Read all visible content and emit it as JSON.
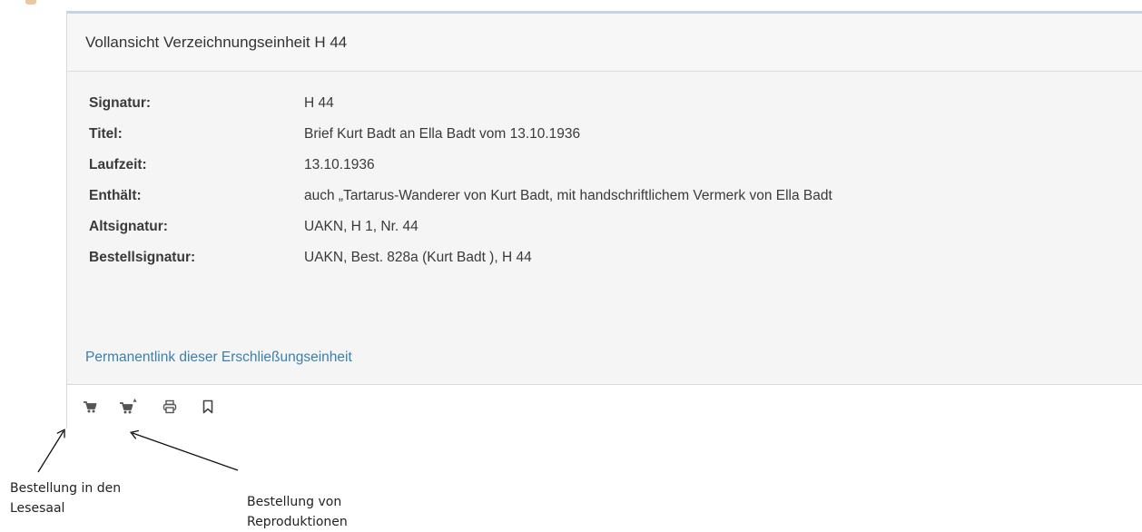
{
  "panel": {
    "title": "Vollansicht Verzeichnungseinheit H 44",
    "rows": [
      {
        "label": "Signatur:",
        "value": "H 44"
      },
      {
        "label": "Titel:",
        "value": "Brief Kurt Badt an Ella Badt vom 13.10.1936"
      },
      {
        "label": "Laufzeit:",
        "value": "13.10.1936"
      },
      {
        "label": "Enthält:",
        "value": "auch „Tartarus-Wanderer von Kurt Badt, mit handschriftlichem Vermerk von Ella Badt"
      },
      {
        "label": "Altsignatur:",
        "value": "UAKN, H 1, Nr. 44"
      },
      {
        "label": "Bestellsignatur:",
        "value": "UAKN, Best. 828a (Kurt Badt ), H 44"
      }
    ],
    "permalink": "Permanentlink dieser Erschließungseinheit"
  },
  "toolbar": {
    "icons": [
      "cart-icon",
      "cart-reproduction-icon",
      "print-icon",
      "bookmark-icon"
    ]
  },
  "annotations": {
    "reading_room_line1": "Bestellung in den",
    "reading_room_line2": "Lesesaal",
    "reproduction_line1": "Bestellung von",
    "reproduction_line2": "Reproduktionen"
  },
  "colors": {
    "link": "#3b7fae",
    "panel_bg": "#f5f5f5",
    "top_border": "#c3d4e3",
    "icon": "#555555"
  }
}
